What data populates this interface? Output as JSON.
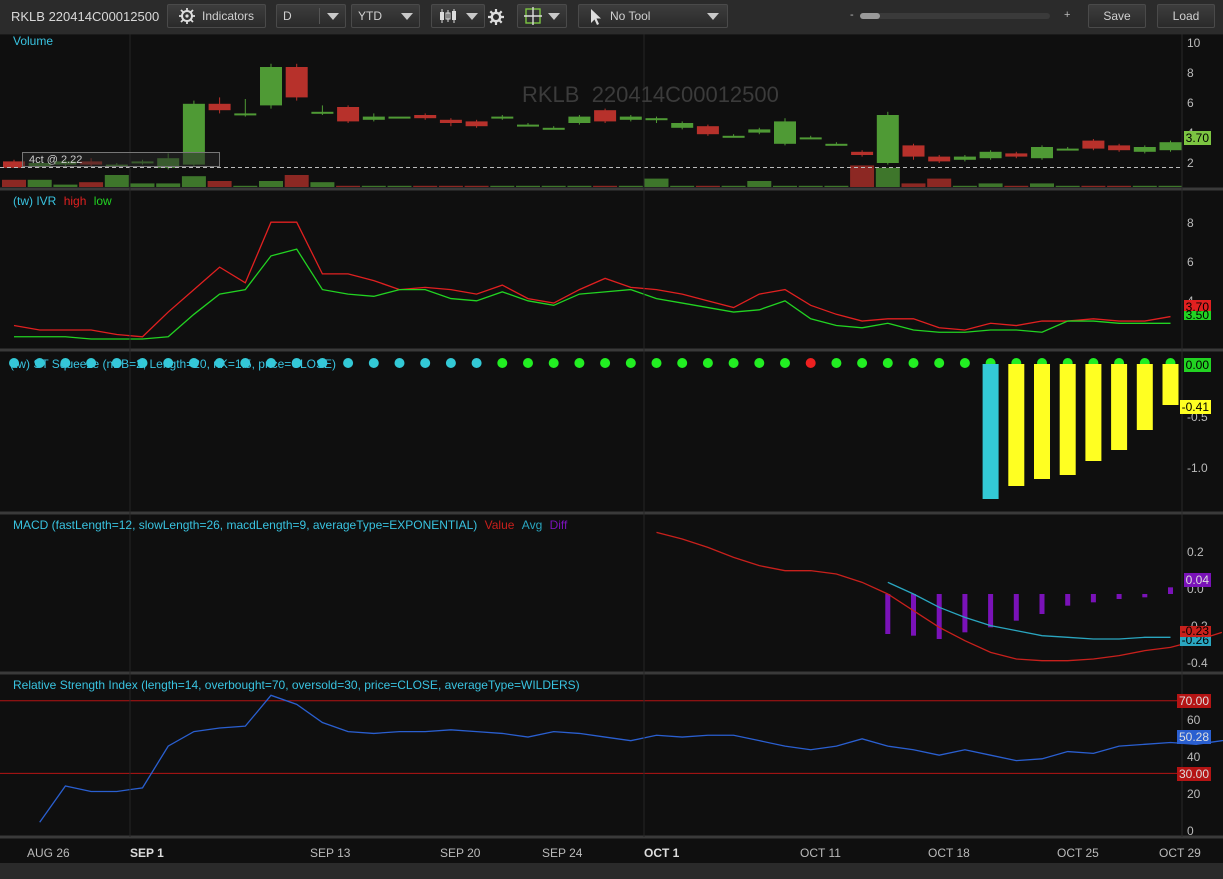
{
  "toolbar": {
    "symbol": "RKLB 220414C00012500",
    "indicators_label": "Indicators",
    "aggregation": "D",
    "range": "YTD",
    "tool": "No Tool",
    "zoom_minus": "-",
    "zoom_plus": "+",
    "save_label": "Save",
    "load_label": "Load"
  },
  "watermark": "RKLB  220414C00012500",
  "panels": {
    "volume": {
      "title": "Volume",
      "ticks": [
        "10",
        "8",
        "6",
        "4",
        "2"
      ],
      "last": "3.70",
      "position_label": "4ct @ 2.22"
    },
    "ivr": {
      "title": "(tw) IVR",
      "high": "high",
      "low": "low",
      "ticks": [
        "8",
        "6",
        "4"
      ],
      "badge_high": "3.70",
      "badge_low": "3.50"
    },
    "squeeze": {
      "title": "(tw) ST Squeeze (nBB=2, Length=20, nK=1.5, price=CLOSE)",
      "ticks": [
        "-0.5",
        "-1.0"
      ],
      "badge_top": "0.00",
      "badge_val": "-0.41"
    },
    "macd": {
      "title": "MACD (fastLength=12, slowLength=26, macdLength=9, averageType=EXPONENTIAL)",
      "value": "Value",
      "avg": "Avg",
      "diff": "Diff",
      "ticks": [
        "0.2",
        "0.0",
        "-0.2",
        "-0.4"
      ],
      "badge_diff": "0.04",
      "badge_value": "-0.23",
      "badge_avg": "-0.26"
    },
    "rsi": {
      "title": "Relative Strength Index (length=14, overbought=70, oversold=30, price=CLOSE, averageType=WILDERS)",
      "ticks": [
        "60",
        "40",
        "20",
        "0"
      ],
      "badge_ob": "70.00",
      "badge_val": "50.28",
      "badge_os": "30.00"
    }
  },
  "x_axis": [
    "AUG 26",
    "SEP 1",
    "SEP 13",
    "SEP 20",
    "SEP 24",
    "OCT 1",
    "OCT 11",
    "OCT 18",
    "OCT 25",
    "OCT 29"
  ],
  "colors": {
    "up": "#4f9a35",
    "down": "#b7312b",
    "ivr_high": "#e02020",
    "ivr_low": "#22d322",
    "cyan": "#33c9d6",
    "yellow": "#ffff22",
    "macd_value": "#c8201c",
    "macd_avg": "#2aa6c0",
    "macd_diff": "#7a12b8",
    "rsi": "#2a5fd0",
    "rsi_lines": "#b41414"
  },
  "chart_data": {
    "candles": {
      "series": [
        {
          "open": 2.6,
          "close": 2.2,
          "high": 2.7,
          "low": 2.2
        },
        {
          "open": 2.3,
          "close": 2.5,
          "high": 2.6,
          "low": 2.2
        },
        {
          "open": 2.4,
          "close": 2.6,
          "high": 2.7,
          "low": 2.3
        },
        {
          "open": 2.6,
          "close": 2.4,
          "high": 2.8,
          "low": 2.3
        },
        {
          "open": 2.4,
          "close": 2.4,
          "high": 2.5,
          "low": 2.3
        },
        {
          "open": 2.5,
          "close": 2.6,
          "high": 2.7,
          "low": 2.4
        },
        {
          "open": 2.2,
          "close": 2.8,
          "high": 3.1,
          "low": 2.1
        },
        {
          "open": 2.4,
          "close": 6.2,
          "high": 6.4,
          "low": 2.3
        },
        {
          "open": 6.2,
          "close": 5.8,
          "high": 6.6,
          "low": 5.6
        },
        {
          "open": 5.6,
          "close": 5.6,
          "high": 6.5,
          "low": 5.4
        },
        {
          "open": 6.1,
          "close": 8.5,
          "high": 8.7,
          "low": 5.9
        },
        {
          "open": 8.5,
          "close": 6.6,
          "high": 8.7,
          "low": 6.4
        },
        {
          "open": 5.7,
          "close": 5.7,
          "high": 6.1,
          "low": 5.5
        },
        {
          "open": 6.0,
          "close": 5.1,
          "high": 6.1,
          "low": 5.0
        },
        {
          "open": 5.2,
          "close": 5.4,
          "high": 5.6,
          "low": 5.1
        },
        {
          "open": 5.4,
          "close": 5.4,
          "high": 5.4,
          "low": 5.4
        },
        {
          "open": 5.5,
          "close": 5.3,
          "high": 5.6,
          "low": 5.2
        },
        {
          "open": 5.2,
          "close": 5.0,
          "high": 5.3,
          "low": 4.8
        },
        {
          "open": 5.1,
          "close": 4.8,
          "high": 5.2,
          "low": 4.7
        },
        {
          "open": 5.3,
          "close": 5.4,
          "high": 5.5,
          "low": 5.2
        },
        {
          "open": 4.9,
          "close": 4.9,
          "high": 5.0,
          "low": 4.8
        },
        {
          "open": 4.7,
          "close": 4.7,
          "high": 4.8,
          "low": 4.6
        },
        {
          "open": 5.0,
          "close": 5.4,
          "high": 5.5,
          "low": 4.9
        },
        {
          "open": 5.8,
          "close": 5.1,
          "high": 5.9,
          "low": 5.0
        },
        {
          "open": 5.2,
          "close": 5.4,
          "high": 5.5,
          "low": 5.1
        },
        {
          "open": 5.2,
          "close": 5.3,
          "high": 5.4,
          "low": 5.0
        },
        {
          "open": 4.7,
          "close": 5.0,
          "high": 5.1,
          "low": 4.6
        },
        {
          "open": 4.8,
          "close": 4.3,
          "high": 4.9,
          "low": 4.2
        },
        {
          "open": 4.2,
          "close": 4.2,
          "high": 4.3,
          "low": 4.1
        },
        {
          "open": 4.4,
          "close": 4.6,
          "high": 4.7,
          "low": 4.3
        },
        {
          "open": 3.7,
          "close": 5.1,
          "high": 5.3,
          "low": 3.6
        },
        {
          "open": 4.1,
          "close": 4.1,
          "high": 4.2,
          "low": 4.0
        },
        {
          "open": 3.7,
          "close": 3.7,
          "high": 3.8,
          "low": 3.6
        },
        {
          "open": 3.2,
          "close": 3.0,
          "high": 3.3,
          "low": 2.9
        },
        {
          "open": 2.5,
          "close": 5.5,
          "high": 5.7,
          "low": 2.4
        },
        {
          "open": 3.6,
          "close": 2.9,
          "high": 3.7,
          "low": 2.7
        },
        {
          "open": 2.9,
          "close": 2.6,
          "high": 3.0,
          "low": 2.5
        },
        {
          "open": 2.7,
          "close": 2.9,
          "high": 3.0,
          "low": 2.6
        },
        {
          "open": 2.8,
          "close": 3.2,
          "high": 3.3,
          "low": 2.7
        },
        {
          "open": 3.1,
          "close": 2.9,
          "high": 3.2,
          "low": 2.8
        },
        {
          "open": 2.8,
          "close": 3.5,
          "high": 3.6,
          "low": 2.7
        },
        {
          "open": 3.4,
          "close": 3.4,
          "high": 3.5,
          "low": 3.3
        },
        {
          "open": 3.9,
          "close": 3.4,
          "high": 4.0,
          "low": 3.3
        },
        {
          "open": 3.6,
          "close": 3.3,
          "high": 3.7,
          "low": 3.2
        },
        {
          "open": 3.2,
          "close": 3.5,
          "high": 3.6,
          "low": 3.1
        },
        {
          "open": 3.3,
          "close": 3.8,
          "high": 3.9,
          "low": 3.2
        }
      ],
      "volumes": [
        0.6,
        0.6,
        0.2,
        0.4,
        1.0,
        0.3,
        0.3,
        0.9,
        0.5,
        0.1,
        0.5,
        1.0,
        0.4,
        0.1,
        0.1,
        0.1,
        0.1,
        0.1,
        0.1,
        0.1,
        0.1,
        0.1,
        0.1,
        0.1,
        0.1,
        0.7,
        0.1,
        0.1,
        0.1,
        0.5,
        0.1,
        0.1,
        0.1,
        1.8,
        1.6,
        0.3,
        0.7,
        0.1,
        0.3,
        0.1,
        0.3,
        0.1,
        0.1,
        0.1,
        0.1,
        0.1
      ],
      "ylim": [
        1,
        10.5
      ]
    },
    "ivr": {
      "high": [
        3.4,
        3.2,
        3.2,
        3.2,
        3.0,
        2.9,
        4.0,
        5.0,
        6.0,
        5.3,
        8.0,
        8.0,
        5.7,
        5.7,
        5.4,
        5.0,
        5.1,
        5.0,
        4.8,
        5.2,
        4.6,
        4.4,
        5.0,
        5.5,
        5.1,
        5.0,
        4.8,
        4.5,
        4.2,
        4.8,
        5.0,
        4.3,
        3.9,
        3.6,
        3.7,
        3.7,
        3.3,
        3.2,
        3.5,
        3.4,
        3.6,
        3.6,
        3.7,
        3.6,
        3.6,
        3.8
      ],
      "low": [
        2.9,
        2.9,
        2.9,
        2.8,
        2.8,
        2.8,
        2.9,
        3.9,
        4.8,
        5.0,
        6.5,
        6.8,
        5.0,
        4.8,
        4.7,
        5.0,
        5.0,
        4.6,
        4.5,
        4.9,
        4.5,
        4.3,
        4.8,
        4.9,
        5.0,
        4.6,
        4.4,
        4.2,
        4.0,
        4.1,
        4.5,
        3.7,
        3.4,
        3.3,
        3.5,
        3.2,
        3.1,
        3.1,
        3.2,
        3.2,
        3.1,
        3.6,
        3.6,
        3.5,
        3.5,
        3.5
      ],
      "ylim": [
        2.4,
        9.3
      ]
    },
    "squeeze": {
      "dots": [
        "cyan",
        "cyan",
        "cyan",
        "cyan",
        "cyan",
        "cyan",
        "cyan",
        "cyan",
        "cyan",
        "cyan",
        "cyan",
        "cyan",
        "cyan",
        "cyan",
        "cyan",
        "cyan",
        "cyan",
        "cyan",
        "cyan",
        "green",
        "green",
        "green",
        "green",
        "green",
        "green",
        "green",
        "green",
        "green",
        "green",
        "green",
        "green",
        "red",
        "green",
        "green",
        "green",
        "green",
        "green",
        "green",
        "green",
        "green",
        "green",
        "green",
        "green",
        "green",
        "green",
        "green"
      ],
      "histogram": [
        -1.35,
        -1.22,
        -1.15,
        -1.11,
        -0.97,
        -0.86,
        -0.66,
        -0.41
      ],
      "ylim": [
        -1.45,
        0.05
      ]
    },
    "macd": {
      "value_start_index": 25,
      "value": [
        0.37,
        0.33,
        0.28,
        0.22,
        0.17,
        0.14,
        0.14,
        0.12,
        0.07,
        0.0,
        -0.1,
        -0.2,
        -0.28,
        -0.35,
        -0.39,
        -0.4,
        -0.4,
        -0.39,
        -0.37,
        -0.34,
        -0.32,
        -0.28,
        -0.23
      ],
      "avg_start_index": 34,
      "avg": [
        0.07,
        0.0,
        -0.08,
        -0.14,
        -0.19,
        -0.22,
        -0.25,
        -0.26,
        -0.27,
        -0.27,
        -0.26,
        -0.26
      ],
      "diff_start_index": 34,
      "diff": [
        -0.24,
        -0.25,
        -0.27,
        -0.23,
        -0.2,
        -0.16,
        -0.12,
        -0.07,
        -0.05,
        -0.03,
        -0.02,
        0.04
      ],
      "ylim": [
        -0.45,
        0.45
      ]
    },
    "rsi": {
      "values": [
        3,
        23,
        20,
        20,
        22,
        45,
        53,
        55,
        56,
        73,
        68,
        58,
        53,
        52,
        53,
        53,
        54,
        53,
        52,
        50,
        53,
        52,
        50,
        48,
        51,
        50,
        51,
        51,
        48,
        45,
        43,
        45,
        49,
        45,
        43,
        40,
        43,
        40,
        37,
        38,
        42,
        41,
        45,
        46,
        47,
        46,
        48,
        50
      ],
      "overbought": 70,
      "oversold": 30,
      "ylim": [
        -4,
        82
      ]
    }
  }
}
